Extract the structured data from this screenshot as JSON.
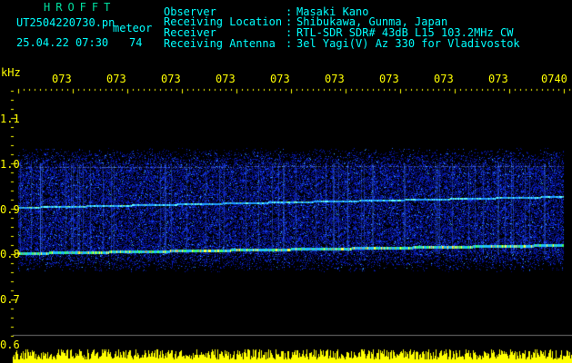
{
  "header": {
    "logo": "HROFFT",
    "filename": "UT2504220730.pn",
    "subtitle": "meteor",
    "datetime": "25.04.22 07:30",
    "count": "74",
    "info": [
      {
        "label": "Observer",
        "value": "Masaki Kano"
      },
      {
        "label": "Receiving Location",
        "value": "Shibukawa, Gunma, Japan"
      },
      {
        "label": "Receiver",
        "value": "RTL-SDR SDR# 43dB L15 103.2MHz CW"
      },
      {
        "label": "Receiving Antenna",
        "value": "3el Yagi(V) Az 330 for Vladivostok"
      }
    ]
  },
  "axes": {
    "unit": "kHz",
    "time_labels": [
      "073",
      "073",
      "073",
      "073",
      "073",
      "073",
      "073",
      "073",
      "073",
      "0740"
    ],
    "freq_labels": [
      "1.1",
      "1.0",
      "0.9",
      "0.8",
      "0.7",
      "0.6"
    ]
  },
  "colors": {
    "text_header": "#00ffff",
    "axis_text": "#ffff00",
    "background": "#000000",
    "logo": "#00e0a0"
  }
}
